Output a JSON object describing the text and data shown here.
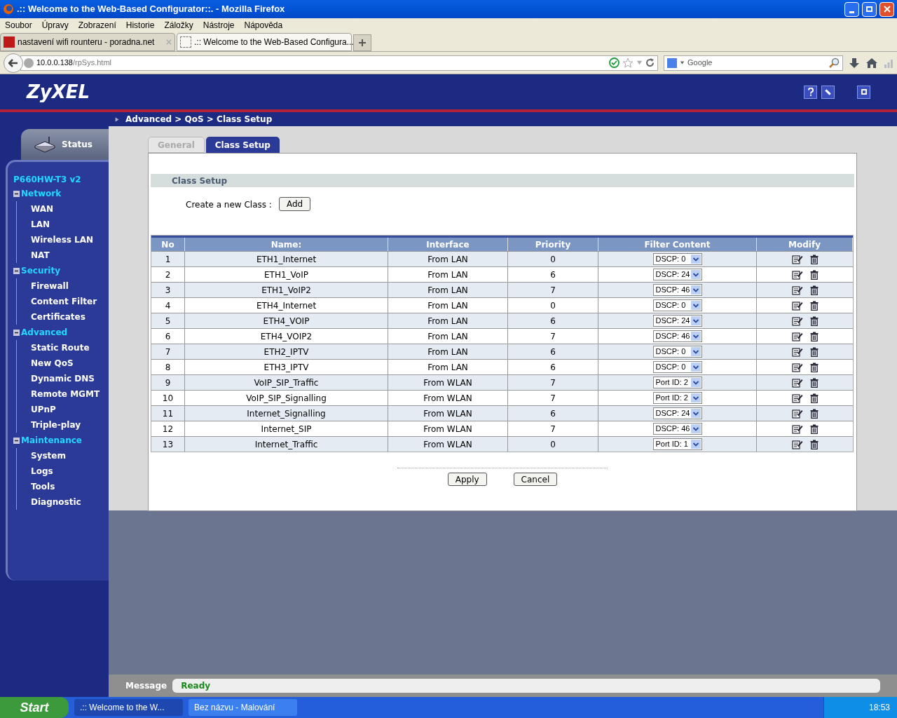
{
  "window": {
    "title": ".:: Welcome to the Web-Based Configurator::. - Mozilla Firefox"
  },
  "menu": [
    "Soubor",
    "Úpravy",
    "Zobrazení",
    "Historie",
    "Záložky",
    "Nástroje",
    "Nápověda"
  ],
  "browser_tabs": [
    {
      "label": "nastavení wifi rounteru - poradna.net",
      "selected": false
    },
    {
      "label": ".:: Welcome to the Web-Based Configura...",
      "selected": true
    }
  ],
  "address": {
    "host": "10.0.0.138",
    "path": "/rpSys.html"
  },
  "search": {
    "placeholder": "Google"
  },
  "header": {
    "logo": "ZyXEL"
  },
  "breadcrumb": "Advanced > QoS > Class Setup",
  "sidebar": {
    "status_tab": "Status",
    "model": "P660HW-T3 v2",
    "sections": [
      {
        "label": "Network",
        "expanded": true,
        "children": [
          "WAN",
          "LAN",
          "Wireless LAN",
          "NAT"
        ]
      },
      {
        "label": "Security",
        "expanded": true,
        "children": [
          "Firewall",
          "Content Filter",
          "Certificates"
        ]
      },
      {
        "label": "Advanced",
        "expanded": true,
        "children": [
          "Static Route",
          "New QoS",
          "Dynamic DNS",
          "Remote MGMT",
          "UPnP",
          "Triple-play"
        ]
      },
      {
        "label": "Maintenance",
        "expanded": true,
        "children": [
          "System",
          "Logs",
          "Tools",
          "Diagnostic"
        ]
      }
    ]
  },
  "page_tabs": [
    {
      "label": "General",
      "selected": false
    },
    {
      "label": "Class Setup",
      "selected": true
    }
  ],
  "section_title": "Class Setup",
  "create": {
    "label": "Create a new Class :",
    "button": "Add"
  },
  "table": {
    "columns": [
      "No",
      "Name:",
      "Interface",
      "Priority",
      "Filter Content",
      "Modify"
    ],
    "rows": [
      {
        "no": "1",
        "name": "ETH1_Internet",
        "interface": "From LAN",
        "priority": "0",
        "filter": "DSCP: 0"
      },
      {
        "no": "2",
        "name": "ETH1_VoIP",
        "interface": "From LAN",
        "priority": "6",
        "filter": "DSCP: 24"
      },
      {
        "no": "3",
        "name": "ETH1_VoIP2",
        "interface": "From LAN",
        "priority": "7",
        "filter": "DSCP: 46"
      },
      {
        "no": "4",
        "name": "ETH4_Internet",
        "interface": "From LAN",
        "priority": "0",
        "filter": "DSCP: 0"
      },
      {
        "no": "5",
        "name": "ETH4_VOIP",
        "interface": "From LAN",
        "priority": "6",
        "filter": "DSCP: 24"
      },
      {
        "no": "6",
        "name": "ETH4_VOIP2",
        "interface": "From LAN",
        "priority": "7",
        "filter": "DSCP: 46"
      },
      {
        "no": "7",
        "name": "ETH2_IPTV",
        "interface": "From LAN",
        "priority": "6",
        "filter": "DSCP: 0"
      },
      {
        "no": "8",
        "name": "ETH3_IPTV",
        "interface": "From LAN",
        "priority": "6",
        "filter": "DSCP: 0"
      },
      {
        "no": "9",
        "name": "VoIP_SIP_Traffic",
        "interface": "From WLAN",
        "priority": "7",
        "filter": "Port ID: 2"
      },
      {
        "no": "10",
        "name": "VoIP_SIP_Signalling",
        "interface": "From WLAN",
        "priority": "7",
        "filter": "Port ID: 2"
      },
      {
        "no": "11",
        "name": "Internet_Signalling",
        "interface": "From WLAN",
        "priority": "6",
        "filter": "DSCP: 24"
      },
      {
        "no": "12",
        "name": "Internet_SIP",
        "interface": "From WLAN",
        "priority": "7",
        "filter": "DSCP: 46"
      },
      {
        "no": "13",
        "name": "Internet_Traffic",
        "interface": "From WLAN",
        "priority": "0",
        "filter": "Port ID: 1"
      }
    ]
  },
  "buttons": [
    "Apply",
    "Cancel"
  ],
  "message": {
    "label": "Message",
    "text": "Ready"
  },
  "taskbar": {
    "start": "Start",
    "items": [
      {
        "label": ".:: Welcome to the W...",
        "selected": true
      },
      {
        "label": "Bez názvu - Malování",
        "selected": false
      }
    ],
    "clock": "18:53"
  }
}
